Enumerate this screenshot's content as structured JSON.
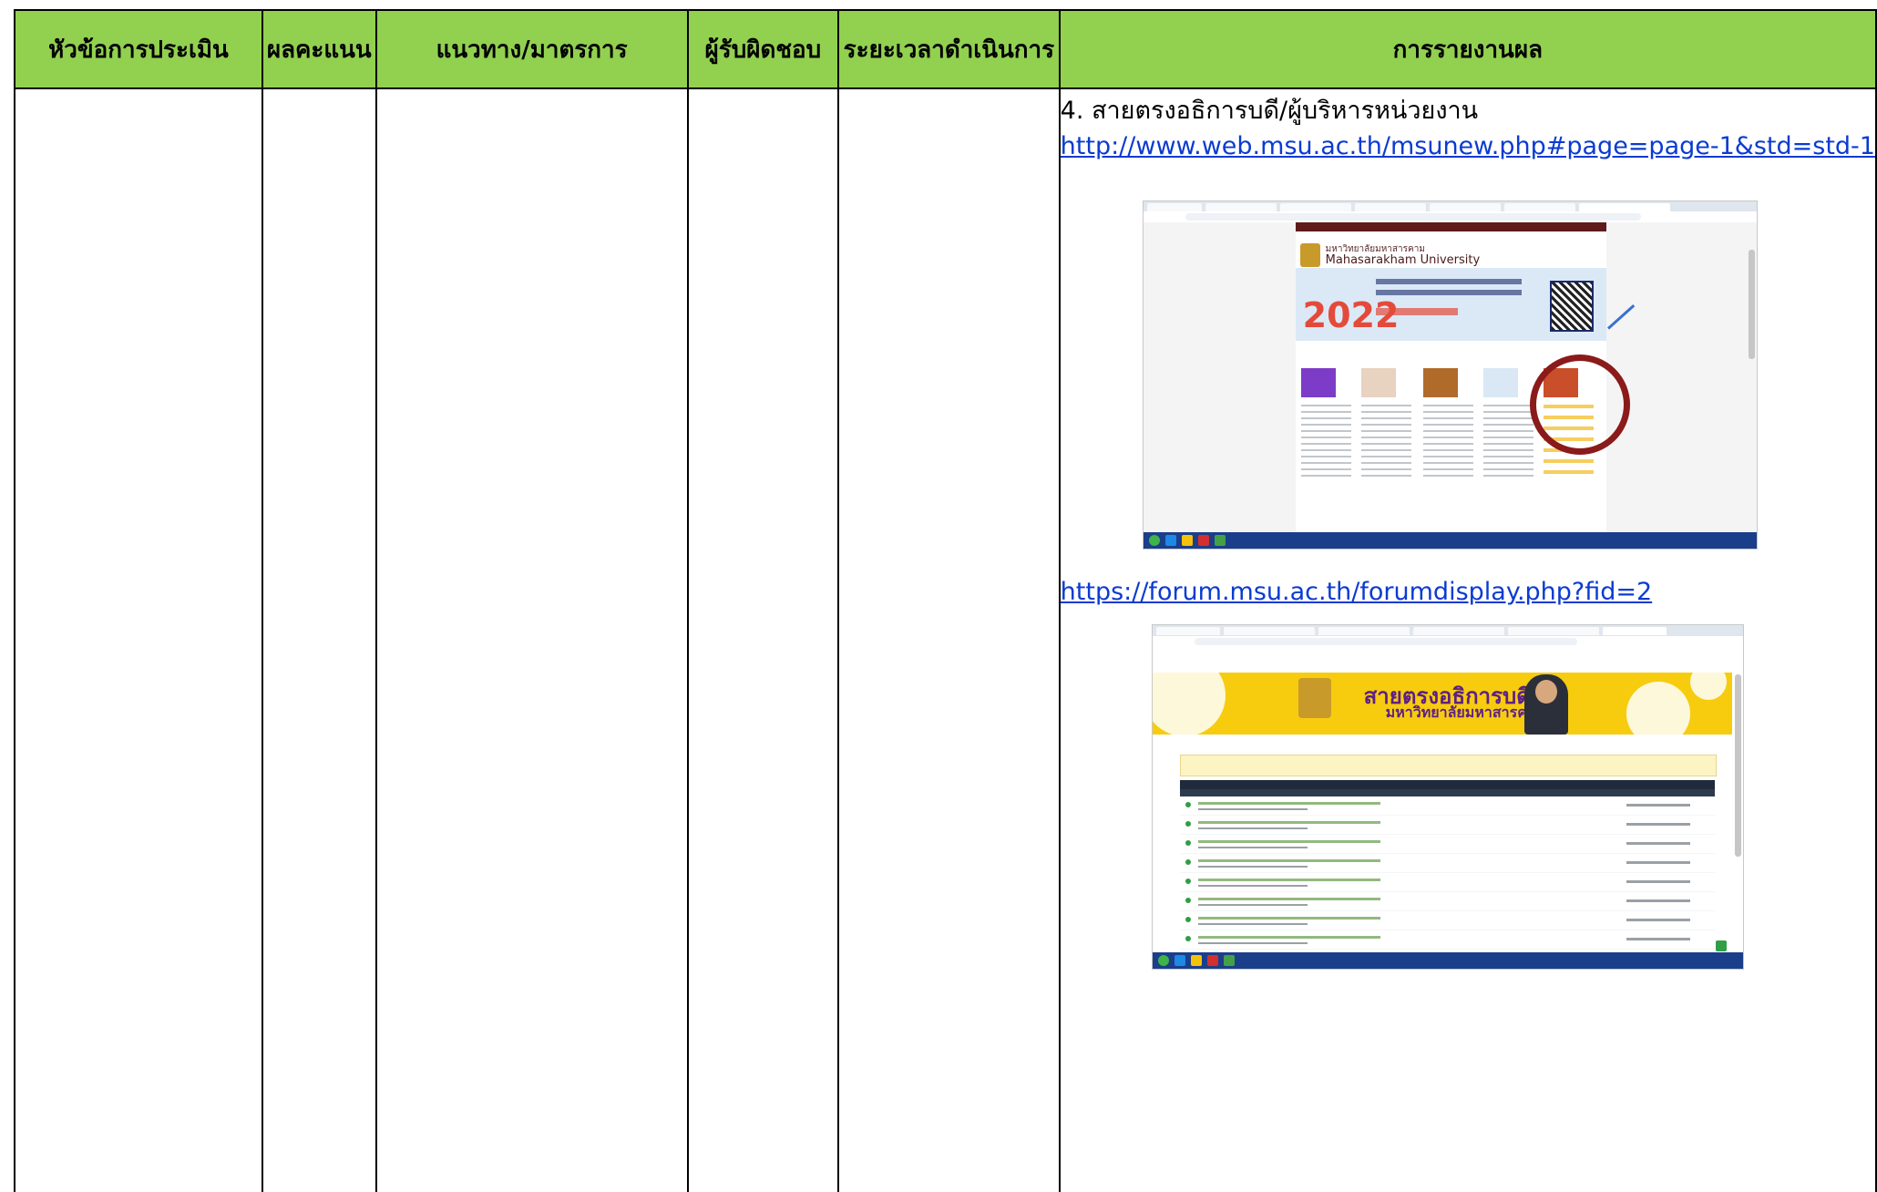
{
  "table": {
    "headers": [
      "หัวข้อการประเมิน",
      "ผลคะแนน",
      "แนวทาง/มาตรการ",
      "ผู้รับผิดชอบ",
      "ระยะเวลาดำเนินการ",
      "การรายงานผล"
    ],
    "header_color": "#92d050"
  },
  "report": {
    "item": "4. สายตรงอธิการบดี/ผู้บริหารหน่วยงาน",
    "link1": "http://www.web.msu.ac.th/msunew.php#page=page-1&std=std-1",
    "link2": "https://forum.msu.ac.th/forumdisplay.php?fid=2"
  },
  "screenshot1": {
    "university_th": "มหาวิทยาลัยมหาสารคาม",
    "university_en": "Mahasarakham University",
    "banner_year": "2022",
    "highlight_color": "#8b1a1a"
  },
  "screenshot2": {
    "title": "สายตรงอธิการบดี",
    "subtitle": "มหาวิทยาลัยมหาสารคาม",
    "banner_color": "#f7cc0f"
  }
}
